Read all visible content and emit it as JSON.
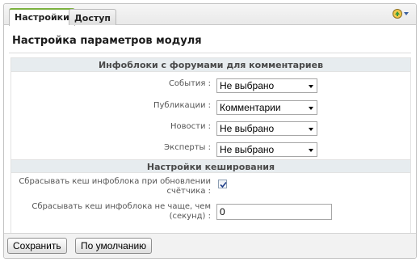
{
  "tabs": [
    {
      "label": "Настройки",
      "active": true
    },
    {
      "label": "Доступ",
      "active": false
    }
  ],
  "header_icon": "settings-menu-icon",
  "title": "Настройка параметров модуля",
  "sections": {
    "comments": {
      "title": "Инфоблоки с форумами для комментариев",
      "fields": [
        {
          "label": "События :",
          "value": "Не выбрано"
        },
        {
          "label": "Публикации :",
          "value": "Комментарии"
        },
        {
          "label": "Новости :",
          "value": "Не выбрано"
        },
        {
          "label": "Эксперты :",
          "value": "Не выбрано"
        }
      ]
    },
    "cache": {
      "title": "Настройки кеширования",
      "clear_on_update": {
        "label_line1": "Сбрасывать кеш инфоблока при обновлении",
        "label_line2": "счётчика :",
        "checked": true
      },
      "min_interval": {
        "label_line1": "Сбрасывать кеш инфоблока не чаще, чем",
        "label_line2": "(секунд) :",
        "value": "0"
      }
    }
  },
  "buttons": {
    "save": "Сохранить",
    "defaults": "По умолчанию"
  },
  "colors": {
    "active_tab_accent": "#7bb13f",
    "section_header_bg": "#e7ecef"
  }
}
